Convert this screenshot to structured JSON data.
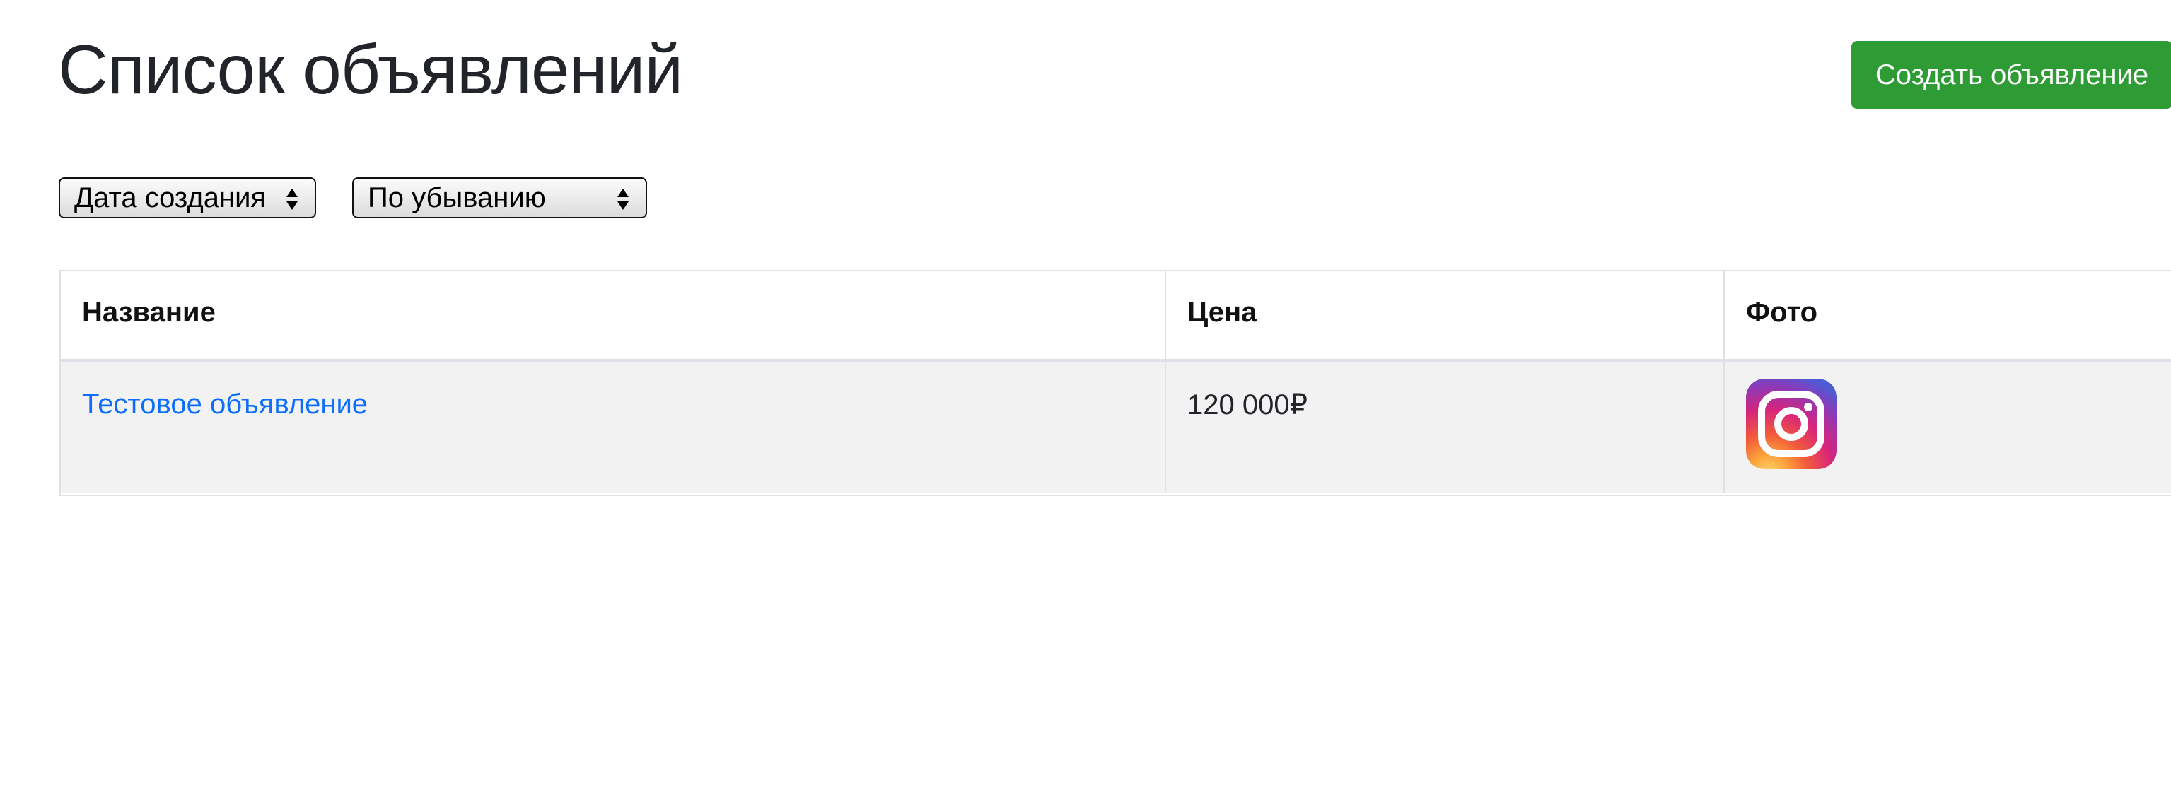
{
  "page": {
    "title": "Список объявлений",
    "create_button_label": "Создать объявление"
  },
  "filters": {
    "sort_field": "Дата создания",
    "sort_order": "По убыванию"
  },
  "table": {
    "columns": [
      "Название",
      "Цена",
      "Фото"
    ],
    "rows": [
      {
        "name": "Тестовое объявление",
        "price": "120 000₽",
        "photo_icon": "instagram-icon"
      }
    ]
  },
  "colors": {
    "accent_green": "#2f9b35",
    "link_blue": "#0d6efd",
    "row_background": "#f2f2f2",
    "border": "#dee2e6"
  }
}
